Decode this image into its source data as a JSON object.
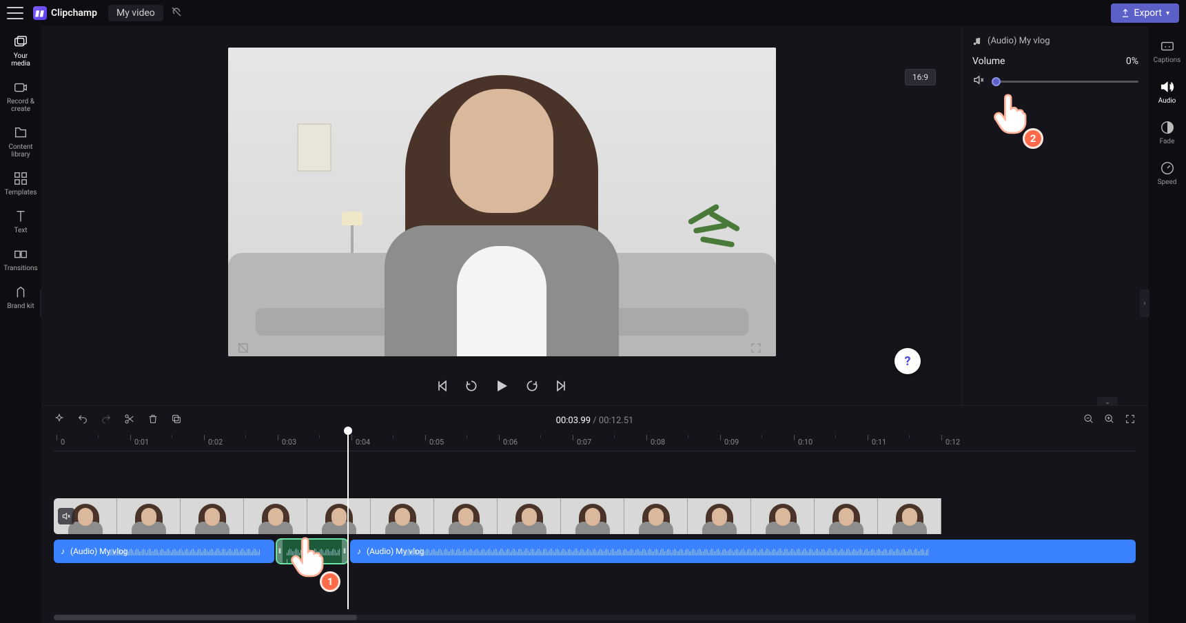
{
  "header": {
    "brand": "Clipchamp",
    "project_title": "My video",
    "export_label": "Export"
  },
  "left_sidebar": [
    {
      "id": "your-media",
      "label": "Your media"
    },
    {
      "id": "record-create",
      "label": "Record & create"
    },
    {
      "id": "content-library",
      "label": "Content library"
    },
    {
      "id": "templates",
      "label": "Templates"
    },
    {
      "id": "text",
      "label": "Text"
    },
    {
      "id": "transitions",
      "label": "Transitions"
    },
    {
      "id": "brand-kit",
      "label": "Brand kit"
    }
  ],
  "stage": {
    "aspect_ratio": "16:9"
  },
  "playback": {
    "current_time": "00:03.99",
    "total_time": "00:12.51"
  },
  "ruler_marks": [
    "0",
    "0:01",
    "0:02",
    "0:03",
    "0:04",
    "0:05",
    "0:06",
    "0:07",
    "0:08",
    "0:09",
    "0:10",
    "0:11",
    "0:12"
  ],
  "audio_clips": [
    {
      "label": "(Audio) My vlog"
    },
    {
      "label": ""
    },
    {
      "label": "(Audio) My vlog"
    }
  ],
  "props": {
    "track_name": "(Audio) My vlog",
    "volume_label": "Volume",
    "volume_value": "0%"
  },
  "right_rail": [
    {
      "id": "captions",
      "label": "Captions"
    },
    {
      "id": "audio",
      "label": "Audio"
    },
    {
      "id": "fade",
      "label": "Fade"
    },
    {
      "id": "speed",
      "label": "Speed"
    }
  ],
  "annotations": {
    "pointer1": "1",
    "pointer2": "2"
  }
}
